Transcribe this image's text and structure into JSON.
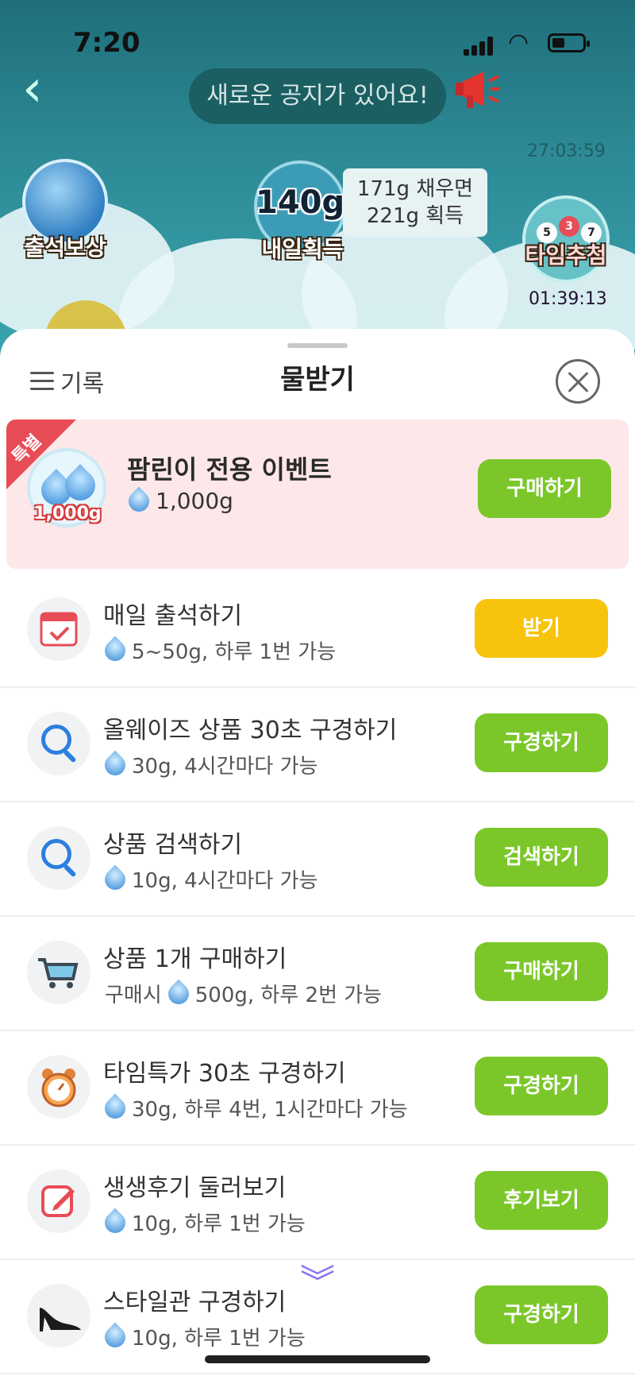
{
  "status_bar": {
    "time": "7:20"
  },
  "top": {
    "notice": "새로운 공지가 있어요!",
    "timer_top": "27:03:59",
    "attendance_label": "출석보상",
    "tomorrow_amount": "140g",
    "tomorrow_label": "내일획득",
    "fill_info_line1": "171g 채우면",
    "fill_info_line2": "221g 획득",
    "lotto_label": "타임추첨",
    "lotto_balls": [
      "5",
      "3",
      "7"
    ],
    "timer_bottom": "01:39:13"
  },
  "sheet": {
    "history_label": "기록",
    "title": "물받기",
    "special": {
      "ribbon": "특별",
      "badge_amount": "1,000g",
      "title": "팜린이 전용 이벤트",
      "amount": "1,000g",
      "button": "구매하기"
    },
    "tasks": [
      {
        "title": "매일 출석하기",
        "prefix": "",
        "desc": "5~50g, 하루 1번 가능",
        "button": "받기",
        "icon": "calendar-icon"
      },
      {
        "title": "올웨이즈 상품 30초 구경하기",
        "prefix": "",
        "desc": "30g, 4시간마다 가능",
        "button": "구경하기",
        "icon": "search-icon"
      },
      {
        "title": "상품 검색하기",
        "prefix": "",
        "desc": "10g, 4시간마다 가능",
        "button": "검색하기",
        "icon": "search-icon"
      },
      {
        "title": "상품 1개 구매하기",
        "prefix": "구매시",
        "desc": "500g, 하루 2번 가능",
        "button": "구매하기",
        "icon": "cart-icon"
      },
      {
        "title": "타임특가 30초 구경하기",
        "prefix": "",
        "desc": "30g, 하루 4번, 1시간마다 가능",
        "button": "구경하기",
        "icon": "alarm-clock-icon"
      },
      {
        "title": "생생후기 둘러보기",
        "prefix": "",
        "desc": "10g, 하루 1번 가능",
        "button": "후기보기",
        "icon": "edit-icon"
      },
      {
        "title": "스타일관 구경하기",
        "prefix": "",
        "desc": "10g, 하루 1번 가능",
        "button": "구경하기",
        "icon": "high-heel-icon"
      }
    ]
  },
  "colors": {
    "green_button": "#7bc72a",
    "yellow_button": "#f7c30d",
    "special_bg": "#fde7e9",
    "ribbon": "#e84c57"
  }
}
